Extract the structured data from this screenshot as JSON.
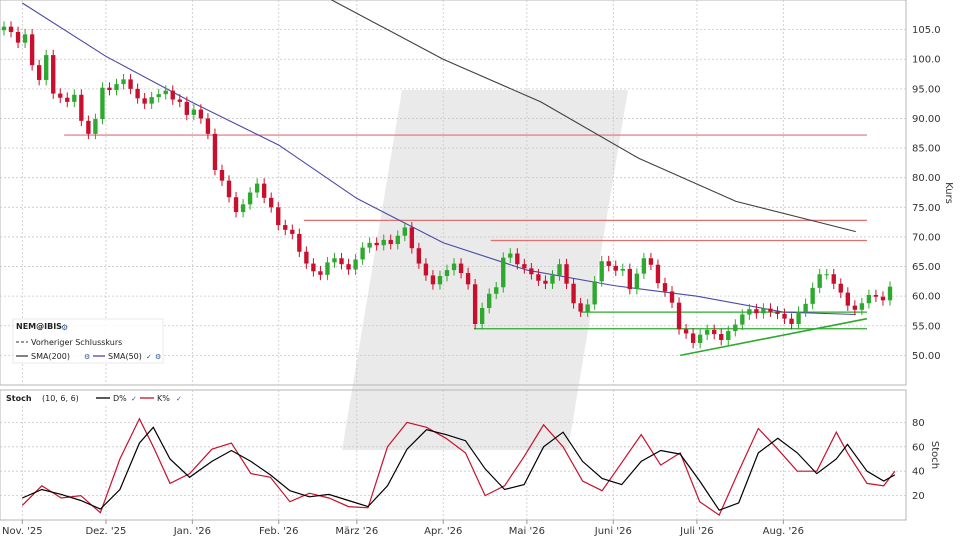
{
  "chart_data": [
    {
      "type": "candlestick",
      "name": "price",
      "symbol": "NEM@IBIS",
      "ylabel": "Kurs",
      "ylim": [
        45,
        110
      ],
      "yticks": [
        50,
        55,
        60,
        65,
        70,
        75,
        80,
        85,
        90,
        95,
        100,
        105
      ],
      "ytick_labels": [
        "50.00",
        "55.00",
        "60.00",
        "65.00",
        "70.00",
        "75.00",
        "80.00",
        "85.00",
        "90.00",
        "95.00",
        "100.0",
        "105.0"
      ],
      "x_months": [
        "Nov. '25",
        "Dez. '25",
        "Jan. '26",
        "Feb. '26",
        "März '26",
        "Apr. '26",
        "Mai '26",
        "Juni '26",
        "Juli '26",
        "Aug. '26"
      ],
      "grid": true,
      "legend": {
        "placement": "bottom-left",
        "title": "NEM@IBIS",
        "entries": [
          "Vorheriger Schlusskurs",
          "SMA(200)",
          "SMA(50)"
        ]
      },
      "series": [
        {
          "name": "NEM@IBIS",
          "color_up": "#2ea82e",
          "color_down": "#c8102e",
          "close": [
            105.5,
            104.6,
            102.8,
            104.2,
            99.0,
            96.5,
            100.7,
            94.2,
            93.5,
            92.8,
            94.0,
            89.6,
            87.4,
            89.9,
            95.2,
            94.8,
            95.8,
            96.6,
            95.0,
            93.4,
            92.5,
            93.6,
            94.1,
            94.7,
            93.2,
            92.8,
            90.6,
            91.5,
            90.0,
            87.4,
            81.3,
            79.5,
            76.7,
            74.2,
            75.5,
            77.5,
            79.0,
            76.6,
            75.0,
            72.0,
            71.2,
            70.5,
            67.5,
            65.5,
            64.2,
            63.6,
            65.7,
            66.4,
            65.4,
            64.5,
            66.2,
            68.2,
            69.0,
            68.6,
            69.5,
            68.8,
            70.2,
            71.6,
            68.1,
            65.5,
            63.5,
            62.0,
            63.4,
            64.4,
            65.5,
            63.9,
            62.0,
            55.3,
            58.0,
            60.4,
            61.5,
            66.5,
            67.2,
            65.4,
            64.7,
            63.7,
            62.6,
            62.1,
            63.5,
            65.4,
            62.1,
            58.8,
            57.4,
            58.6,
            62.5,
            65.9,
            65.1,
            64.3,
            64.6,
            61.2,
            63.8,
            66.4,
            65.3,
            62.2,
            60.8,
            58.9,
            54.4,
            53.7,
            52.1,
            53.5,
            54.3,
            53.6,
            52.6,
            54.1,
            55.2,
            56.9,
            57.8,
            57.1,
            57.9,
            57.4,
            57.0,
            56.2,
            55.3,
            57.4,
            58.7,
            61.4,
            63.7,
            63.7,
            62.1,
            60.6,
            58.4,
            57.7,
            58.8,
            60.2,
            59.9,
            59.3,
            61.6
          ]
        },
        {
          "name": "SMA(200)",
          "color": "#404040",
          "points": [
            [
              "2026-02-16",
              111.0
            ],
            [
              "2026-04-01",
              100.0
            ],
            [
              "2026-05-06",
              92.8
            ],
            [
              "2026-06-10",
              83.3
            ],
            [
              "2026-07-15",
              76.0
            ],
            [
              "2026-08-27",
              70.9
            ]
          ]
        },
        {
          "name": "SMA(50)",
          "color": "#4a4aa8",
          "points": [
            [
              "2025-11-01",
              109.5
            ],
            [
              "2025-12-01",
              100.5
            ],
            [
              "2026-01-01",
              92.7
            ],
            [
              "2026-02-01",
              85.5
            ],
            [
              "2026-03-01",
              76.5
            ],
            [
              "2026-04-01",
              69.0
            ],
            [
              "2026-05-01",
              64.4
            ],
            [
              "2026-06-01",
              61.8
            ],
            [
              "2026-07-01",
              60.0
            ],
            [
              "2026-08-01",
              57.3
            ],
            [
              "2026-08-27",
              56.9
            ]
          ]
        },
        {
          "name": "Vorheriger Schlusskurs",
          "style": "dashed",
          "value": 61.5
        }
      ],
      "hlines": [
        {
          "value": 87.2,
          "color": "#e07070",
          "from": "2025-11-16",
          "to": "2026-08-31"
        },
        {
          "value": 72.8,
          "color": "#e07070",
          "from": "2026-02-10",
          "to": "2026-08-31"
        },
        {
          "value": 69.4,
          "color": "#e07070",
          "from": "2026-04-18",
          "to": "2026-08-31"
        },
        {
          "value": 57.3,
          "color": "#2ea82e",
          "from": "2026-05-20",
          "to": "2026-08-31"
        },
        {
          "value": 54.5,
          "color": "#2ea82e",
          "from": "2026-04-12",
          "to": "2026-08-31"
        }
      ],
      "trendlines": [
        {
          "color": "#2ea82e",
          "from": [
            "2026-06-25",
            50.0
          ],
          "to": [
            "2026-08-31",
            56.2
          ]
        }
      ]
    },
    {
      "type": "line",
      "name": "Stoch",
      "label": "Stoch",
      "params": "(10, 6, 6)",
      "ylim": [
        0,
        100
      ],
      "yticks": [
        20,
        40,
        60,
        80
      ],
      "ylabel": "Stoch",
      "legend": {
        "placement": "top-left",
        "entries": [
          "D%",
          "K%"
        ]
      },
      "series": [
        {
          "name": "D%",
          "color": "#000000",
          "points": [
            [
              "2025-11-01",
              18
            ],
            [
              "2025-11-08",
              25
            ],
            [
              "2025-11-15",
              21
            ],
            [
              "2025-11-22",
              16
            ],
            [
              "2025-11-29",
              9
            ],
            [
              "2025-12-06",
              25
            ],
            [
              "2025-12-13",
              63
            ],
            [
              "2025-12-18",
              76
            ],
            [
              "2025-12-24",
              50
            ],
            [
              "2025-12-31",
              35
            ],
            [
              "2026-01-08",
              48
            ],
            [
              "2026-01-15",
              57
            ],
            [
              "2026-01-22",
              48
            ],
            [
              "2026-01-29",
              37
            ],
            [
              "2026-02-05",
              24
            ],
            [
              "2026-02-12",
              19
            ],
            [
              "2026-02-19",
              21
            ],
            [
              "2026-02-26",
              16
            ],
            [
              "2026-03-05",
              11
            ],
            [
              "2026-03-12",
              28
            ],
            [
              "2026-03-19",
              58
            ],
            [
              "2026-03-26",
              74
            ],
            [
              "2026-04-02",
              70
            ],
            [
              "2026-04-09",
              65
            ],
            [
              "2026-04-16",
              42
            ],
            [
              "2026-04-23",
              25
            ],
            [
              "2026-04-30",
              29
            ],
            [
              "2026-05-07",
              60
            ],
            [
              "2026-05-14",
              72
            ],
            [
              "2026-05-21",
              48
            ],
            [
              "2026-05-28",
              34
            ],
            [
              "2026-06-04",
              29
            ],
            [
              "2026-06-11",
              48
            ],
            [
              "2026-06-18",
              57
            ],
            [
              "2026-06-25",
              54
            ],
            [
              "2026-07-02",
              32
            ],
            [
              "2026-07-09",
              8
            ],
            [
              "2026-07-16",
              14
            ],
            [
              "2026-07-23",
              55
            ],
            [
              "2026-07-30",
              67
            ],
            [
              "2026-08-06",
              55
            ],
            [
              "2026-08-13",
              38
            ],
            [
              "2026-08-20",
              50
            ],
            [
              "2026-08-24",
              62
            ],
            [
              "2026-08-31",
              40
            ],
            [
              "2026-09-06",
              32
            ],
            [
              "2026-09-10",
              37
            ]
          ]
        },
        {
          "name": "K%",
          "color": "#c8102e",
          "points": [
            [
              "2025-11-01",
              12
            ],
            [
              "2025-11-08",
              28
            ],
            [
              "2025-11-15",
              18
            ],
            [
              "2025-11-22",
              20
            ],
            [
              "2025-11-29",
              6
            ],
            [
              "2025-12-06",
              50
            ],
            [
              "2025-12-13",
              83
            ],
            [
              "2025-12-18",
              60
            ],
            [
              "2025-12-24",
              30
            ],
            [
              "2025-12-31",
              38
            ],
            [
              "2026-01-08",
              58
            ],
            [
              "2026-01-15",
              63
            ],
            [
              "2026-01-22",
              38
            ],
            [
              "2026-01-29",
              35
            ],
            [
              "2026-02-05",
              15
            ],
            [
              "2026-02-12",
              22
            ],
            [
              "2026-02-19",
              18
            ],
            [
              "2026-02-26",
              11
            ],
            [
              "2026-03-05",
              10
            ],
            [
              "2026-03-12",
              60
            ],
            [
              "2026-03-19",
              80
            ],
            [
              "2026-03-26",
              76
            ],
            [
              "2026-04-02",
              67
            ],
            [
              "2026-04-09",
              55
            ],
            [
              "2026-04-16",
              20
            ],
            [
              "2026-04-23",
              28
            ],
            [
              "2026-04-30",
              52
            ],
            [
              "2026-05-07",
              78
            ],
            [
              "2026-05-14",
              60
            ],
            [
              "2026-05-21",
              32
            ],
            [
              "2026-05-28",
              24
            ],
            [
              "2026-06-04",
              47
            ],
            [
              "2026-06-11",
              70
            ],
            [
              "2026-06-18",
              45
            ],
            [
              "2026-06-25",
              55
            ],
            [
              "2026-07-02",
              15
            ],
            [
              "2026-07-09",
              4
            ],
            [
              "2026-07-16",
              40
            ],
            [
              "2026-07-23",
              75
            ],
            [
              "2026-07-30",
              58
            ],
            [
              "2026-08-06",
              40
            ],
            [
              "2026-08-13",
              40
            ],
            [
              "2026-08-20",
              72
            ],
            [
              "2026-08-24",
              55
            ],
            [
              "2026-08-31",
              30
            ],
            [
              "2026-09-06",
              28
            ],
            [
              "2026-09-10",
              40
            ]
          ]
        }
      ]
    }
  ]
}
